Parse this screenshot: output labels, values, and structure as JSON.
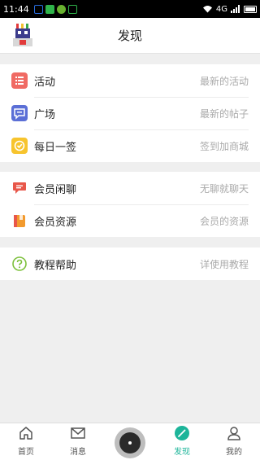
{
  "status_bar": {
    "time": "11:44",
    "network": "4G"
  },
  "header": {
    "title": "发现",
    "avatar_icon": "avatar-icon"
  },
  "groups": [
    {
      "items": [
        {
          "label": "活动",
          "hint": "最新的活动",
          "icon": "list-icon",
          "color": "#f06a63"
        },
        {
          "label": "广场",
          "hint": "最新的帖子",
          "icon": "chat-square-icon",
          "color": "#5b6fd6"
        },
        {
          "label": "每日一签",
          "hint": "签到加商城",
          "icon": "checkin-icon",
          "color": "#f7c42d"
        }
      ]
    },
    {
      "items": [
        {
          "label": "会员闲聊",
          "hint": "无聊就聊天",
          "icon": "chat-bubble-icon",
          "color": "#e8574a"
        },
        {
          "label": "会员资源",
          "hint": "会员的资源",
          "icon": "box-icon",
          "color": "#f29a2e"
        }
      ]
    },
    {
      "items": [
        {
          "label": "教程帮助",
          "hint": "详使用教程",
          "icon": "help-icon",
          "color": "#7cc03b"
        }
      ]
    }
  ],
  "tab_bar": {
    "tabs": [
      {
        "label": "首页",
        "icon": "home-icon"
      },
      {
        "label": "消息",
        "icon": "mail-icon"
      },
      {
        "label": "",
        "icon": "record-icon"
      },
      {
        "label": "发现",
        "icon": "discover-icon",
        "active": true
      },
      {
        "label": "我的",
        "icon": "user-icon"
      }
    ],
    "active_color": "#1db59a"
  }
}
